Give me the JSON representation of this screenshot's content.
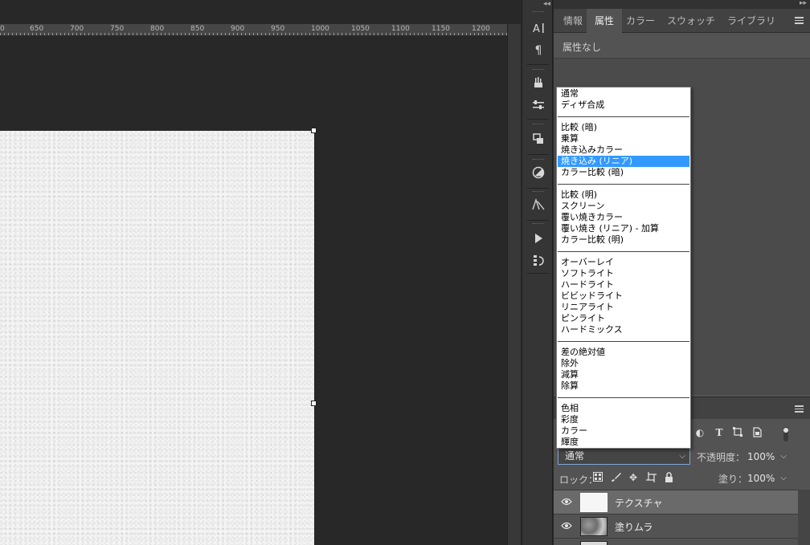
{
  "ruler": {
    "labels": [
      "0",
      "650",
      "700",
      "750",
      "800",
      "850",
      "900",
      "950",
      "1000",
      "1050",
      "1100",
      "1150",
      "1200"
    ]
  },
  "panel": {
    "tabs": [
      "情報",
      "属性",
      "カラー",
      "スウォッチ",
      "ライブラリ"
    ],
    "active_tab": "属性",
    "props_label": "属性なし",
    "collapse_glyph": "◂◂",
    "expand_glyph": "▸▸"
  },
  "blend_modes": {
    "selected": "通常",
    "highlighted": "焼き込み (リニア)",
    "groups": [
      [
        "通常",
        "ディザ合成"
      ],
      [
        "比較 (暗)",
        "乗算",
        "焼き込みカラー",
        "焼き込み (リニア)",
        "カラー比較 (暗)"
      ],
      [
        "比較 (明)",
        "スクリーン",
        "覆い焼きカラー",
        "覆い焼き (リニア) - 加算",
        "カラー比較 (明)"
      ],
      [
        "オーバーレイ",
        "ソフトライト",
        "ハードライト",
        "ビビッドライト",
        "リニアライト",
        "ピンライト",
        "ハードミックス"
      ],
      [
        "差の絶対値",
        "除外",
        "減算",
        "除算"
      ],
      [
        "色相",
        "彩度",
        "カラー",
        "輝度"
      ]
    ]
  },
  "layers": {
    "opacity_label": "不透明度：",
    "opacity_value": "100%",
    "lock_label": "ロック：",
    "fill_label": "塗り：",
    "fill_value": "100%",
    "items": [
      {
        "name": "テクスチャ",
        "selected": true
      },
      {
        "name": "塗りムラ",
        "selected": false
      }
    ]
  },
  "colors": {
    "accent": "#3399ff",
    "panel": "#535353",
    "workspace": "#282828"
  }
}
